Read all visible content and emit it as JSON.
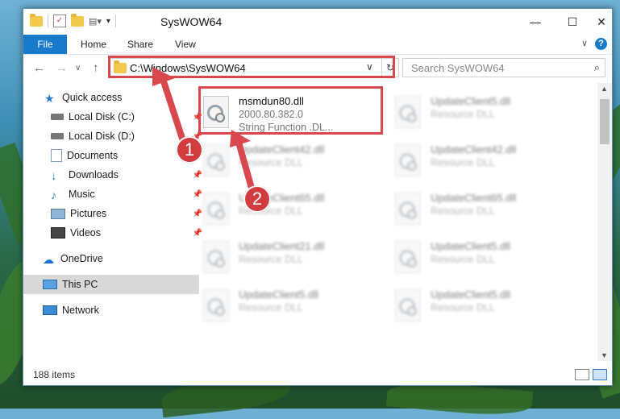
{
  "window": {
    "title": "SysWOW64",
    "minimize": "—",
    "maximize": "☐",
    "close": "✕"
  },
  "ribbon": {
    "file": "File",
    "tabs": [
      "Home",
      "Share",
      "View"
    ],
    "help": "?"
  },
  "address": {
    "path": "C:\\Windows\\SysWOW64",
    "search_placeholder": "Search SysWOW64"
  },
  "sidebar": {
    "items": [
      {
        "label": "Quick access",
        "icon": "star-icon",
        "pinned": false
      },
      {
        "label": "Local Disk (C:)",
        "icon": "drive-icon",
        "pinned": true
      },
      {
        "label": "Local Disk (D:)",
        "icon": "drive-icon",
        "pinned": true
      },
      {
        "label": "Documents",
        "icon": "documents-icon",
        "pinned": true
      },
      {
        "label": "Downloads",
        "icon": "download-icon",
        "pinned": true
      },
      {
        "label": "Music",
        "icon": "music-icon",
        "pinned": true
      },
      {
        "label": "Pictures",
        "icon": "pictures-icon",
        "pinned": true
      },
      {
        "label": "Videos",
        "icon": "videos-icon",
        "pinned": true
      },
      {
        "label": "OneDrive",
        "icon": "cloud-icon",
        "pinned": false
      },
      {
        "label": "This PC",
        "icon": "computer-icon",
        "pinned": false
      },
      {
        "label": "Network",
        "icon": "network-icon",
        "pinned": false
      }
    ]
  },
  "files": [
    {
      "name": "msmdun80.dll",
      "line2": "2000.80.382.0",
      "line3": "String Function .DL..."
    },
    {
      "name": "UpdateClient5.dll",
      "line2": "Resource DLL",
      "line3": ""
    },
    {
      "name": "UpdateClient42.dll",
      "line2": "Resource DLL",
      "line3": ""
    },
    {
      "name": "UpdateClient42.dll",
      "line2": "Resource DLL",
      "line3": ""
    },
    {
      "name": "UpdateClient65.dll",
      "line2": "Resource DLL",
      "line3": ""
    },
    {
      "name": "UpdateClient65.dll",
      "line2": "Resource DLL",
      "line3": ""
    },
    {
      "name": "UpdateClient21.dll",
      "line2": "Resource DLL",
      "line3": ""
    },
    {
      "name": "UpdateClient5.dll",
      "line2": "Resource DLL",
      "line3": ""
    },
    {
      "name": "UpdateClient5.dll",
      "line2": "Resource DLL",
      "line3": ""
    },
    {
      "name": "UpdateClient5.dll",
      "line2": "Resource DLL",
      "line3": ""
    }
  ],
  "status": {
    "count": "188 items"
  },
  "annotations": {
    "marker1": "1",
    "marker2": "2",
    "color": "#d9484d"
  }
}
